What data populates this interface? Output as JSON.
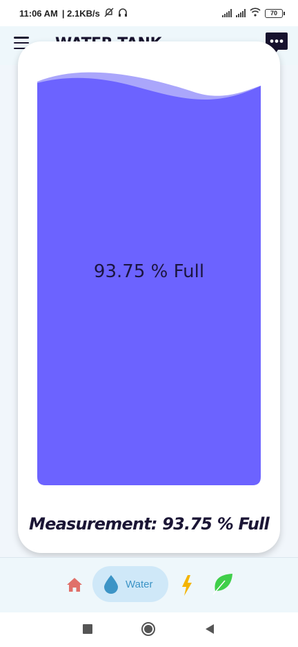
{
  "status_bar": {
    "time": "11:06 AM",
    "net_speed": "| 2.1KB/s",
    "battery": "70"
  },
  "app_bar": {
    "title": "WATER TANK",
    "menu_icon": "hamburger-menu-icon",
    "chat_icon": "chat-bubble-icon"
  },
  "tank": {
    "level_percent": 93.75,
    "label": "93.75 % Full",
    "fill_color": "#6c63ff",
    "wave_color": "#aaa6fb"
  },
  "measurement": {
    "text": "Measurement: 93.75 % Full"
  },
  "bottom_nav": {
    "items": [
      {
        "icon": "home-icon",
        "color": "#e0706a"
      },
      {
        "icon": "water-drop-icon",
        "label": "Water",
        "color": "#3c94c6",
        "active": true
      },
      {
        "icon": "lightning-icon",
        "color": "#f4b400"
      },
      {
        "icon": "leaf-icon",
        "color": "#3fcf4a"
      }
    ]
  }
}
